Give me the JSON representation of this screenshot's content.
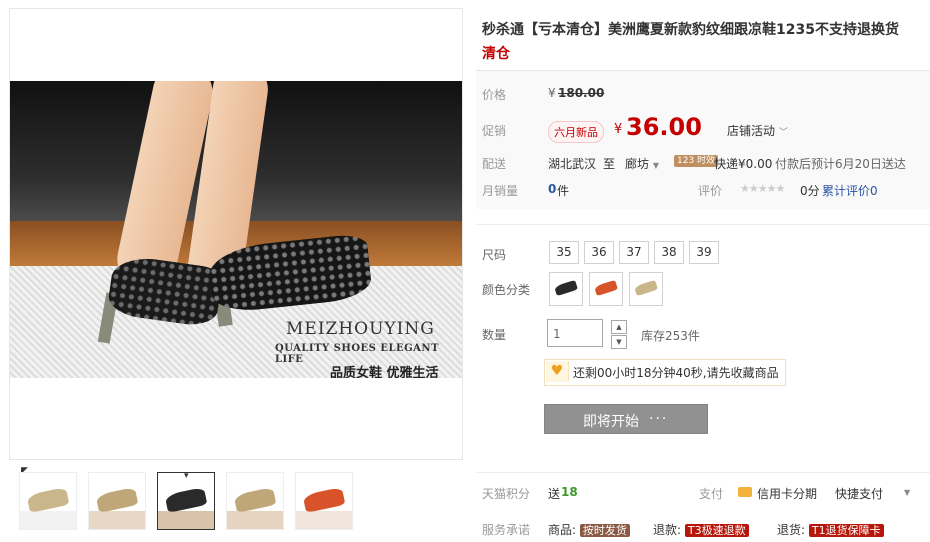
{
  "gallery": {
    "brand_text": "MEIZHOUYING",
    "tagline": "QUALITY SHOES ELEGANT LIFE",
    "slogan": "品质女鞋  优雅生活",
    "thumbnails": [
      {
        "shoe_color": "#c9b68a",
        "floor": "#f2f2f2"
      },
      {
        "shoe_color": "#bfa77a",
        "floor": "#e8d7c6"
      },
      {
        "shoe_color": "#2a2a2a",
        "floor": "#d9c3ab"
      },
      {
        "shoe_color": "#bfa77a",
        "floor": "#e6d4c0"
      },
      {
        "shoe_color": "#d9532a",
        "floor": "#efe5dd"
      }
    ],
    "active_thumbnail": 2
  },
  "product": {
    "title_prefix": "秒杀通【亏本清仓】美洲鹰夏新款豹纹细跟凉鞋1235不支持退换货",
    "title_highlight": "清仓",
    "price_label": "价格",
    "original_price_symbol": "¥",
    "original_price": "180.00",
    "promo_label": "促销",
    "promo_badge": "六月新品",
    "promo_price_symbol": "¥",
    "promo_price": "36.00",
    "store_activity": "店铺活动",
    "shipping_label": "配送",
    "ship_from": "湖北武汉",
    "ship_to_word": "至",
    "ship_to": "廊坊",
    "ship_tag": "123 时效",
    "ship_fee": "快递¥0.00",
    "ship_eta": "付款后预计6月20日送达",
    "monthly_sales_label": "月销量",
    "monthly_sales_value": "0",
    "monthly_sales_unit": "件",
    "rating_label": "评价",
    "rating_stars": "★★★★★",
    "rating_score": "0分",
    "review_count": "累计评价0"
  },
  "options": {
    "size_label": "尺码",
    "sizes": [
      "35",
      "36",
      "37",
      "38",
      "39"
    ],
    "color_label": "颜色分类",
    "colors": [
      "#2a2a2a",
      "#d9532a",
      "#c9b68a"
    ],
    "quantity_label": "数量",
    "quantity_value": "1",
    "stock_text": "库存253件"
  },
  "notice": {
    "text": "还剩00小时18分钟40秒,请先收藏商品"
  },
  "buy_button": {
    "label": "即将开始",
    "dots": "···"
  },
  "footer": {
    "points_label": "天猫积分",
    "points_send": "送",
    "points_value": "18",
    "pay_label": "支付",
    "credit_card": "信用卡分期",
    "quick_pay": "快捷支付",
    "service_label": "服务承诺",
    "service_goods": "商品:",
    "service_goods_tag": "按时发货",
    "service_refund": "退款:",
    "service_refund_tag": "T3极速退款",
    "service_return": "退货:",
    "service_return_tag": "T1退货保障卡"
  }
}
